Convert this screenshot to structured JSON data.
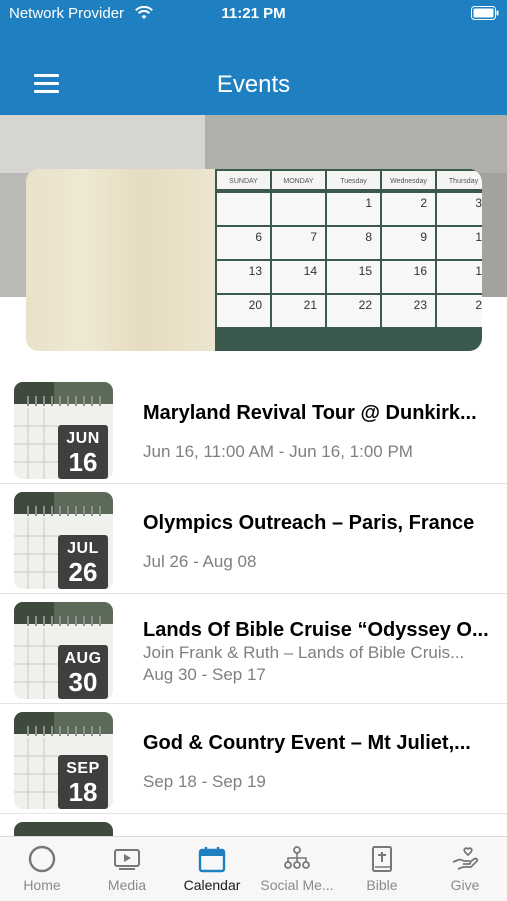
{
  "status_bar": {
    "carrier": "Network Provider",
    "time": "11:21 PM"
  },
  "header": {
    "title": "Events",
    "menu_icon": "hamburger-icon"
  },
  "banner": {
    "calendar_days": [
      "SUNDAY",
      "MONDAY",
      "Tuesday",
      "Wednesday",
      "Thursday"
    ],
    "calendar_rows": [
      [
        "",
        "",
        "1",
        "2",
        "3"
      ],
      [
        "6",
        "7",
        "8",
        "9",
        "1"
      ],
      [
        "13",
        "14",
        "15",
        "16",
        "1"
      ],
      [
        "20",
        "21",
        "22",
        "23",
        "2"
      ]
    ]
  },
  "events": [
    {
      "month": "JUN",
      "day": "16",
      "title": "Maryland Revival Tour @ Dunkirk...",
      "subtitle": "",
      "dates": "Jun 16, 11:00 AM - Jun 16, 1:00 PM"
    },
    {
      "month": "JUL",
      "day": "26",
      "title": "Olympics Outreach – Paris, France",
      "subtitle": "",
      "dates": "Jul 26 - Aug 08"
    },
    {
      "month": "AUG",
      "day": "30",
      "title": "Lands Of Bible Cruise “Odyssey O...",
      "subtitle": "Join Frank & Ruth – Lands of Bible Cruis...",
      "dates": "Aug 30 - Sep 17"
    },
    {
      "month": "SEP",
      "day": "18",
      "title": "God & Country Event – Mt Juliet,...",
      "subtitle": "",
      "dates": "Sep 18 - Sep 19"
    }
  ],
  "tabs": [
    {
      "label": "Home",
      "icon": "home-circle-icon",
      "active": false
    },
    {
      "label": "Media",
      "icon": "media-play-icon",
      "active": false
    },
    {
      "label": "Calendar",
      "icon": "calendar-icon",
      "active": true
    },
    {
      "label": "Social Me...",
      "icon": "social-network-icon",
      "active": false
    },
    {
      "label": "Bible",
      "icon": "bible-icon",
      "active": false
    },
    {
      "label": "Give",
      "icon": "give-hand-icon",
      "active": false
    }
  ],
  "colors": {
    "header_bg": "#1e80c1",
    "accent": "#1e80c1",
    "tab_inactive": "#8a8a8a"
  }
}
